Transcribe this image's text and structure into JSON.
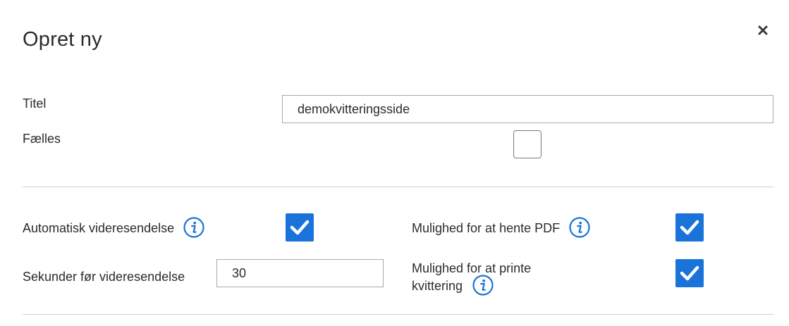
{
  "dialog": {
    "title": "Opret ny",
    "close_icon": "close-icon"
  },
  "fields": {
    "titel": {
      "label": "Titel",
      "value": "demokvitteringsside"
    },
    "faelles": {
      "label": "Fælles",
      "checked": false
    },
    "auto_forward": {
      "label": "Automatisk videresendelse",
      "checked": true,
      "info_icon": "info-icon"
    },
    "seconds": {
      "label": "Sekunder før videresendelse",
      "value": "30"
    },
    "pdf": {
      "label": "Mulighed for at hente PDF",
      "checked": true,
      "info_icon": "info-icon"
    },
    "print": {
      "label_line1": "Mulighed for at printe",
      "label_line2": "kvittering",
      "checked": true,
      "info_icon": "info-icon"
    }
  },
  "colors": {
    "accent": "#1a73d9",
    "text": "#2b2b2b",
    "divider": "#d3d3d3"
  }
}
